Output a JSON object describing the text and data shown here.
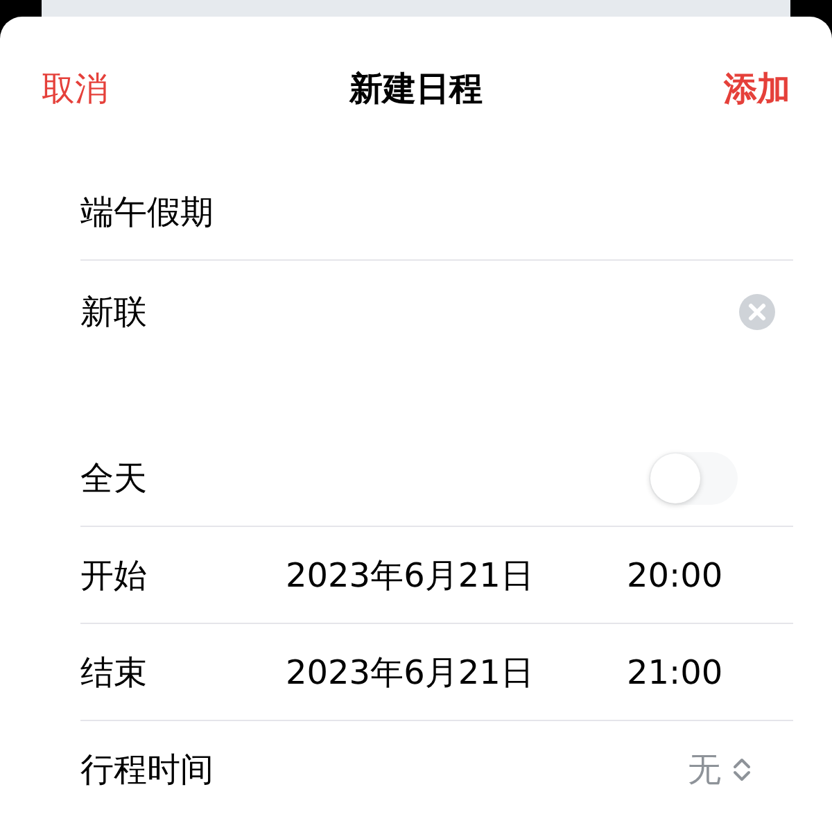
{
  "header": {
    "cancel": "取消",
    "title": "新建日程",
    "add": "添加"
  },
  "title_field": {
    "value": "端午假期"
  },
  "location_field": {
    "value": "新联"
  },
  "all_day": {
    "label": "全天",
    "on": false
  },
  "times": [
    {
      "label": "开始",
      "date": "2023年6月21日",
      "time": "20:00"
    },
    {
      "label": "结束",
      "date": "2023年6月21日",
      "time": "21:00"
    }
  ],
  "travel_time": {
    "label": "行程时间",
    "value": "无"
  }
}
